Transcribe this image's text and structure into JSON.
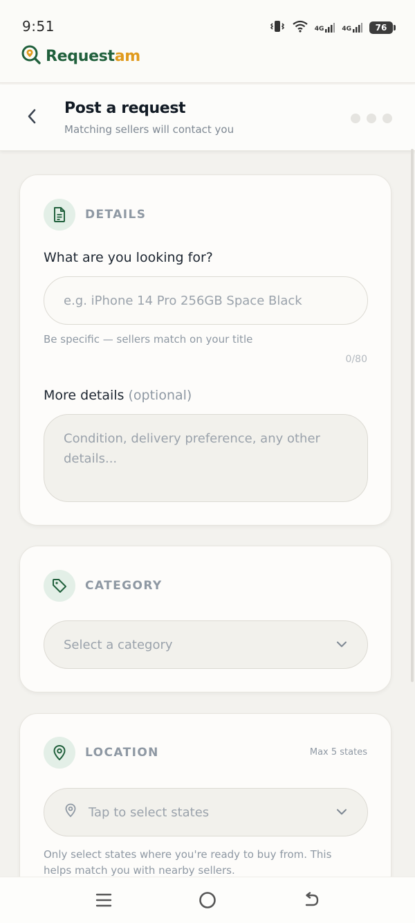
{
  "status": {
    "time": "9:51",
    "network_1": "4G",
    "network_2": "4G",
    "battery": "76"
  },
  "brand": {
    "name_prefix": "Request",
    "name_accent": "am",
    "colors": {
      "primary": "#20603c",
      "accent": "#e09a1c"
    }
  },
  "header": {
    "title": "Post a request",
    "subtitle": "Matching sellers will contact you",
    "step_count": 3
  },
  "details": {
    "section_label": "DETAILS",
    "title_label": "What are you looking for?",
    "title_placeholder": "e.g. iPhone 14 Pro 256GB Space Black",
    "title_hint": "Be specific — sellers match on your title",
    "title_counter": "0/80",
    "more_label": "More details",
    "more_optional": "(optional)",
    "more_placeholder": "Condition, delivery preference, any other details..."
  },
  "category": {
    "section_label": "CATEGORY",
    "select_placeholder": "Select a category"
  },
  "location": {
    "section_label": "LOCATION",
    "note": "Max 5 states",
    "select_placeholder": "Tap to select states",
    "help_text": "Only select states where you're ready to buy from. This helps match you with nearby sellers."
  },
  "icons": {
    "back": "chevron-left-icon",
    "details": "document-icon",
    "category": "tag-icon",
    "location": "map-pin-icon",
    "nav_menu": "menu-icon",
    "nav_home": "home-circle-icon",
    "nav_back": "back-arrow-icon"
  }
}
